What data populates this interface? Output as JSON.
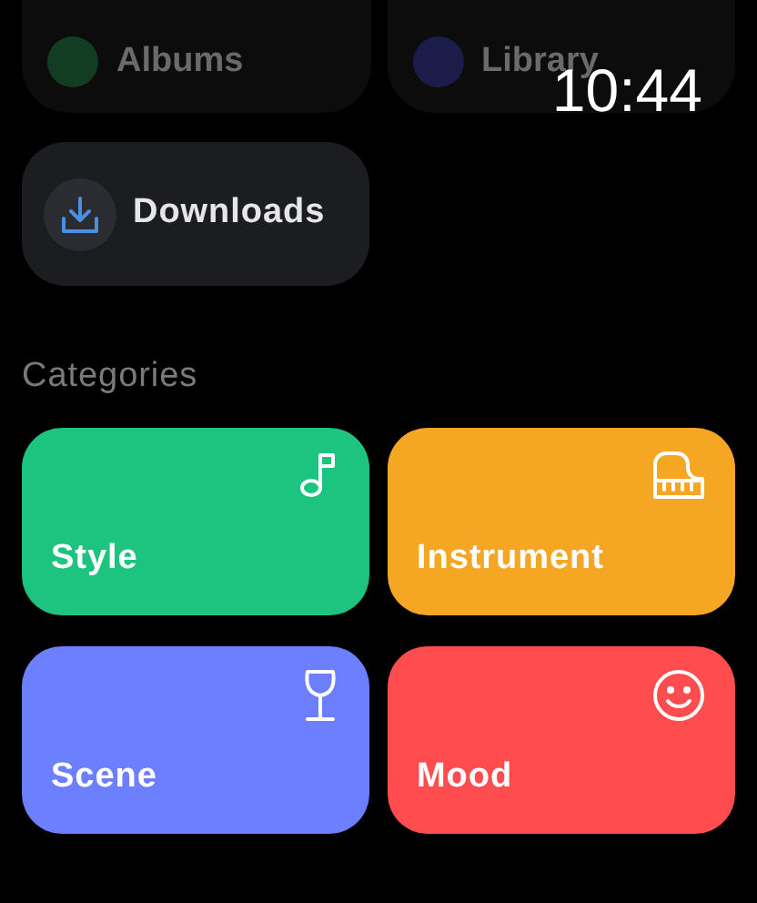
{
  "time": "10:44",
  "top_tiles": [
    {
      "label": "Albums",
      "color": "#123d22"
    },
    {
      "label": "Library",
      "color": "#1b1c4a"
    }
  ],
  "downloads": {
    "label": "Downloads"
  },
  "section_title": "Categories",
  "categories": [
    {
      "label": "Style",
      "kind": "note",
      "color": "#1cc47f"
    },
    {
      "label": "Instrument",
      "kind": "piano",
      "color": "#f5a623"
    },
    {
      "label": "Scene",
      "kind": "glass",
      "color": "#6b7fff"
    },
    {
      "label": "Mood",
      "kind": "smile",
      "color": "#ff4d4f"
    }
  ]
}
